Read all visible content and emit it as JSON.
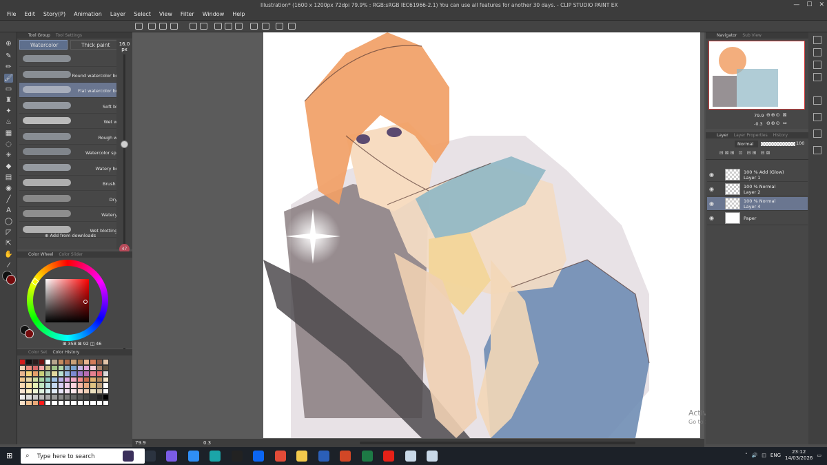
{
  "window": {
    "title": "Illustration* (1600 x 1200px 72dpi 79.9% : RGB:sRGB IEC61966-2.1)  You can use all features for another 30 days. - CLIP STUDIO PAINT EX"
  },
  "menu": [
    "File",
    "Edit",
    "Story(P)",
    "Animation",
    "Layer",
    "Select",
    "View",
    "Filter",
    "Window",
    "Help"
  ],
  "tool_group_panel": {
    "tabs": [
      "Tool Group",
      "Tool Settings"
    ],
    "subtool_tabs": [
      "Watercolor",
      "Thick paint"
    ],
    "brushes": [
      {
        "name": "",
        "color": "#9aa0a8"
      },
      {
        "name": "Round watercolor brush",
        "color": "#9aa0a8"
      },
      {
        "name": "Flat watercolor brush",
        "color": "#b7bcc6",
        "selected": true
      },
      {
        "name": "Soft bleed",
        "color": "#a8aeb6"
      },
      {
        "name": "Wet wash",
        "color": "#d8d8d8"
      },
      {
        "name": "Rough wash",
        "color": "#9aa0a8"
      },
      {
        "name": "Watercolor splash",
        "color": "#8f959c"
      },
      {
        "name": "Watery brush",
        "color": "#aab0b8"
      },
      {
        "name": "Brush pen",
        "color": "#c8c8c8"
      },
      {
        "name": "Dry ink",
        "color": "#9a9a9a"
      },
      {
        "name": "Watery ink",
        "color": "#a0a0a0"
      },
      {
        "name": "Wet blotting ink",
        "color": "#cccccc"
      }
    ],
    "add_from_downloads": "Add from downloads",
    "brush_size": "16.0",
    "brush_size_unit": "px",
    "opacity": "47"
  },
  "color_wheel_panel": {
    "tabs": [
      "Color Wheel",
      "Color Slider"
    ],
    "hsv": {
      "h": "358",
      "s": "92",
      "v": "46"
    },
    "main_color": "#760b0d",
    "sub_color": "#111111"
  },
  "color_set_panel": {
    "tabs": [
      "Color Set",
      "Color History"
    ],
    "swatches": [
      "#d21c1c",
      "#111111",
      "#2a1d1d",
      "#6e1111",
      "#ffffff",
      "#b5a58e",
      "#c48b5f",
      "#ad6b49",
      "#c9a078",
      "#a6774f",
      "#e8b590",
      "#d47c5a",
      "#8a5a46",
      "#e2c4a9",
      "#f1d1b5",
      "#e98c7c",
      "#d66a6a",
      "#f3a7a7",
      "#c8c08a",
      "#9fc28a",
      "#b1d6a7",
      "#88a8c4",
      "#7aa3d1",
      "#c5b6e4",
      "#e2a6d6",
      "#f3cdd9",
      "#a8826a",
      "#5d5040",
      "#e7b58f",
      "#f5d37b",
      "#e6a06b",
      "#c8d07a",
      "#a4c3a1",
      "#e2d79e",
      "#b7dfd2",
      "#97b5df",
      "#7d8ad0",
      "#9e76c7",
      "#b86db3",
      "#e5808f",
      "#e26b6b",
      "#d9d9d9",
      "#f0c78f",
      "#e8d7a7",
      "#cfe0a3",
      "#a7d6a3",
      "#8cc9c1",
      "#9fc0e5",
      "#b9b1e7",
      "#dca7df",
      "#f0a9c3",
      "#f28c8c",
      "#cc6b4e",
      "#e0b070",
      "#b48a5e",
      "#f5e6c8",
      "#f7d8b1",
      "#fbe4a4",
      "#e5f0b5",
      "#c2e6c1",
      "#b4e1e3",
      "#c5d8f0",
      "#d7cff2",
      "#efcfea",
      "#f9d2dc",
      "#f5b7a6",
      "#e9a981",
      "#ddc183",
      "#bfa07a",
      "#ffffff",
      "#f9e6d5",
      "#fff1c7",
      "#eff7d6",
      "#dff2df",
      "#d8f1f2",
      "#e1ebf8",
      "#e9e5f9",
      "#f6e4f3",
      "#fde7ec",
      "#fad6cc",
      "#f0cdb5",
      "#ece0bf",
      "#d7c7ad",
      "#ffffff",
      "#eeeeee",
      "#dddddd",
      "#cccccc",
      "#bbbbbb",
      "#aaaaaa",
      "#999999",
      "#888888",
      "#777777",
      "#666666",
      "#555555",
      "#444444",
      "#333333",
      "#222222",
      "#000000",
      "#fbe0c8",
      "#f0c090",
      "#e8a878",
      "#ff1a1a",
      "#ffffff",
      "#ffffff",
      "#ffffff",
      "#ffffff",
      "#ffffff",
      "#ffffff",
      "#ffffff",
      "#ffffff",
      "#ffffff",
      "#ffffff"
    ]
  },
  "navigator_panel": {
    "tabs": [
      "Navigator",
      "Sub View"
    ],
    "zoom": "79.9",
    "rotation": "-0.3"
  },
  "layer_panel": {
    "tabs": [
      "Layer",
      "Layer Properties",
      "History"
    ],
    "blend_mode": "Normal",
    "opacity": "100",
    "layers": [
      {
        "line1": "100 % Add (Glow)",
        "line2": "Layer 1",
        "selected": false
      },
      {
        "line1": "100 % Normal",
        "line2": "Layer 2",
        "selected": false
      },
      {
        "line1": "100 % Normal",
        "line2": "Layer 4",
        "selected": true
      },
      {
        "line1": "",
        "line2": "Paper",
        "selected": false
      }
    ]
  },
  "status": {
    "zoom": "79.9",
    "rotation": "0.3"
  },
  "taskbar": {
    "search_placeholder": "Type here to search",
    "language": "ENG",
    "time": "23:12",
    "date": "14/03/2026",
    "app_icons": [
      {
        "icon": "game-icon",
        "color": "#3a2f5b"
      },
      {
        "icon": "task-view-icon",
        "color": "#2b3340"
      },
      {
        "icon": "copilot-icon",
        "color": "#7b5ce6"
      },
      {
        "icon": "copilot2-icon",
        "color": "#2f8ef5"
      },
      {
        "icon": "edge-icon",
        "color": "#1ba5a8"
      },
      {
        "icon": "penguin-icon",
        "color": "#222222"
      },
      {
        "icon": "zalo-icon",
        "color": "#0b66f4"
      },
      {
        "icon": "chrome-icon",
        "color": "#e24b38"
      },
      {
        "icon": "explorer-icon",
        "color": "#f2c94c"
      },
      {
        "icon": "word-icon",
        "color": "#2b5fb8"
      },
      {
        "icon": "powerpoint-icon",
        "color": "#d24726"
      },
      {
        "icon": "excel-icon",
        "color": "#1d7a45"
      },
      {
        "icon": "youtube-icon",
        "color": "#e62117"
      },
      {
        "icon": "csp-icon",
        "color": "#c9d9e8"
      },
      {
        "icon": "csp2-icon",
        "color": "#c9d9e8"
      }
    ]
  },
  "watermark": {
    "line1": "Activate Windows",
    "line2": "Go to Settings to activate Windows."
  }
}
